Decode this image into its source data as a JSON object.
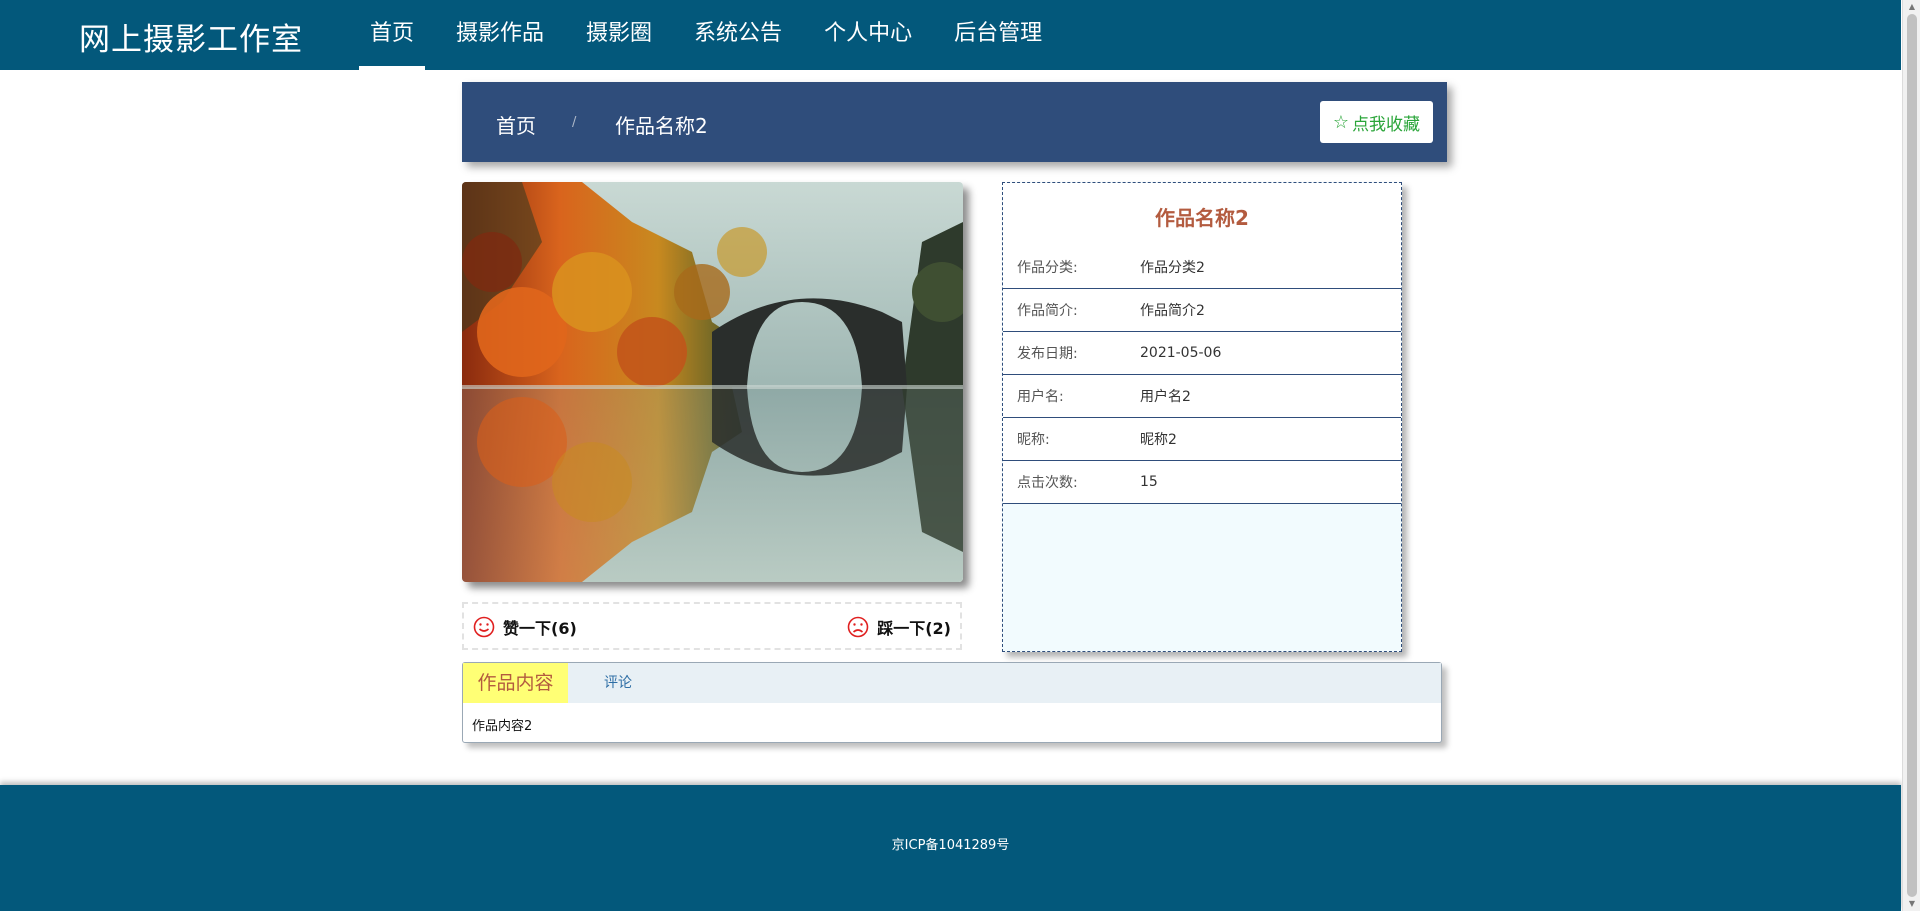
{
  "header": {
    "brand": "网上摄影工作室",
    "nav": [
      {
        "label": "首页"
      },
      {
        "label": "摄影作品"
      },
      {
        "label": "摄影圈"
      },
      {
        "label": "系统公告"
      },
      {
        "label": "个人中心"
      },
      {
        "label": "后台管理"
      }
    ],
    "active_index": 0
  },
  "breadcrumb": {
    "home": "首页",
    "separator": "/",
    "current": "作品名称2"
  },
  "favorite_button": {
    "icon": "star-outline-icon",
    "label": "点我收藏"
  },
  "photo": {
    "description_icon": "photo-image"
  },
  "votes": {
    "like_label": "赞一下(6)",
    "dislike_label": "踩一下(2)",
    "like_icon": "smile-icon",
    "dislike_icon": "frown-icon"
  },
  "details": {
    "title": "作品名称2",
    "rows": [
      {
        "label": "作品分类:",
        "value": "作品分类2"
      },
      {
        "label": "作品简介:",
        "value": "作品简介2"
      },
      {
        "label": "发布日期:",
        "value": "2021-05-06"
      },
      {
        "label": "用户名:",
        "value": "用户名2"
      },
      {
        "label": "昵称:",
        "value": "昵称2"
      },
      {
        "label": "点击次数:",
        "value": "15"
      }
    ]
  },
  "tabs": {
    "items": [
      {
        "label": "作品内容"
      },
      {
        "label": "评论"
      }
    ],
    "content": "作品内容2"
  },
  "footer": {
    "text": "京ICP备1041289号"
  },
  "colors": {
    "nav_bg": "#03587b",
    "crumb_bg": "#2f4d7b",
    "title_color": "#b35b3f",
    "fav_green": "#2aa539",
    "tab_active_bg": "#ffff75",
    "vote_icon_red": "#e02020"
  }
}
